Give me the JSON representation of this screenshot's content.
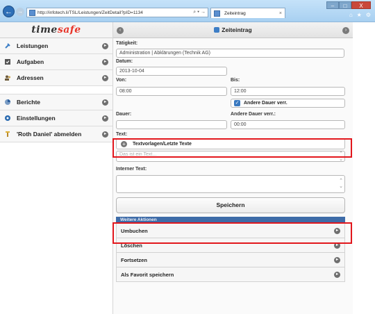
{
  "browser": {
    "url": "http://infotech.li/TSL/Leistungen/ZeitDetail?pID=1134",
    "address_icons": "⌕ ▾ →",
    "tab_title": "Zeiteintrag",
    "tab_close": "×",
    "minimize": "–",
    "maximize": "□",
    "close": "X"
  },
  "app": {
    "brand_prefix": "time",
    "brand_accent": "safe",
    "page_title": "Zeiteintrag"
  },
  "sidebar": {
    "items": [
      {
        "label": "Leistungen",
        "icon": "tools-icon"
      },
      {
        "label": "Aufgaben",
        "icon": "tasks-icon"
      },
      {
        "label": "Adressen",
        "icon": "contacts-icon"
      },
      {
        "label": "Berichte",
        "icon": "reports-icon"
      },
      {
        "label": "Einstellungen",
        "icon": "settings-icon"
      },
      {
        "label": "'Roth Daniel' abmelden",
        "icon": "logout-icon"
      }
    ]
  },
  "form": {
    "taetigkeit_label": "Tätigkeit:",
    "taetigkeit_value": "Administration | Abklärungen (Technik AG)",
    "datum_label": "Datum:",
    "datum_value": "2013-10-04",
    "von_label": "Von:",
    "von_value": "08:00",
    "bis_label": "Bis:",
    "bis_value": "12:00",
    "andere_dauer_checkbox": "Andere Dauer verr.",
    "dauer_label": "Dauer:",
    "dauer_value": "",
    "andere_dauer_label": "Andere Dauer verr.:",
    "andere_dauer_value": "00:00",
    "text_label": "Text:",
    "textvorlagen_label": "Textvorlagen/Letzte Texte",
    "text_value": "Das ist ein Text...",
    "interner_text_label": "Interner Text:",
    "interner_text_value": "",
    "save_label": "Speichern"
  },
  "actions": {
    "header": "Weitere Aktionen",
    "items": [
      "Umbuchen",
      "Löschen",
      "Fortsetzen",
      "Als Favorit speichern"
    ]
  },
  "colors": {
    "brand_accent": "#e8352a",
    "actions_header": "#3e6ca8",
    "highlight": "#e2161c",
    "checkbox": "#3a79c0"
  }
}
